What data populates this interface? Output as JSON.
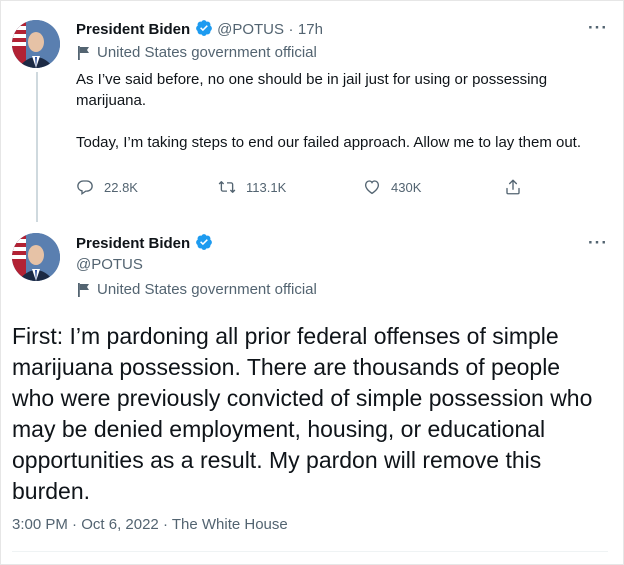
{
  "tweet1": {
    "author_name": "President Biden",
    "handle": "@POTUS",
    "separator": "·",
    "time": "17h",
    "label": "United States government official",
    "text_p1": "As I’ve said before, no one should be in jail just for using or possessing marijuana.",
    "text_p2": "Today, I’m taking steps to end our failed approach. Allow me to lay them out.",
    "replies": "22.8K",
    "retweets": "113.1K",
    "likes": "430K",
    "more": "···"
  },
  "tweet2": {
    "author_name": "President Biden",
    "handle": "@POTUS",
    "label": "United States government official",
    "text": "First: I’m pardoning all prior federal offenses of simple marijuana possession. There are thousands of people who were previously convicted of simple possession who may be denied employment, housing, or educational opportunities as a result. My pardon will remove this burden.",
    "time": "3:00 PM",
    "date": "Oct 6, 2022",
    "source": "The White House",
    "separator": "·",
    "more": "···"
  },
  "colors": {
    "verified": "#1d9bf0",
    "muted": "#536471",
    "text": "#0f1419"
  },
  "icons": [
    "verified-badge-icon",
    "flag-icon",
    "reply-icon",
    "retweet-icon",
    "like-icon",
    "share-icon",
    "more-icon"
  ]
}
